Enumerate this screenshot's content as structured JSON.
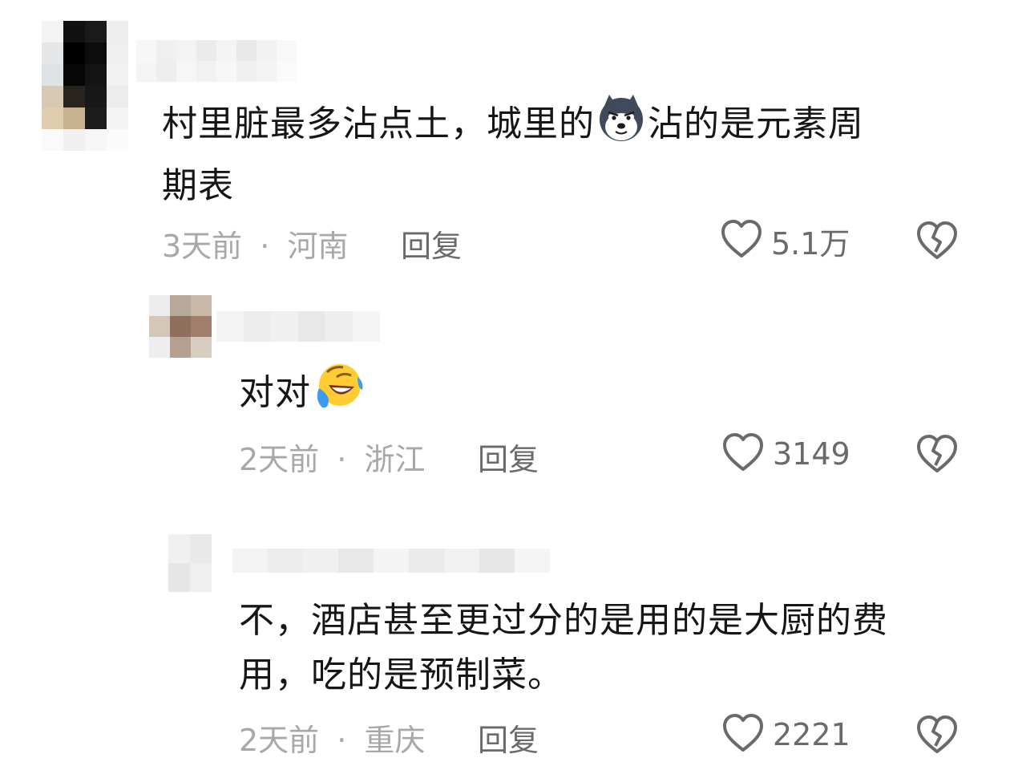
{
  "comments": [
    {
      "text_line1": "村里脏最多沾点土，城里的",
      "emoji": "husky-dog-emoji",
      "text_line1b": "沾的是元素周",
      "text_line2": "期表",
      "time": "3天前",
      "separator": "·",
      "location": "河南",
      "reply_label": "回复",
      "likes": "5.1万"
    },
    {
      "text_line1": "对对",
      "emoji": "rolling-laughing-emoji",
      "time": "2天前",
      "separator": "·",
      "location": "浙江",
      "reply_label": "回复",
      "likes": "3149"
    },
    {
      "text_line1": "不，酒店甚至更过分的是用的是大厨的费",
      "text_line2": "用，吃的是预制菜。",
      "time": "2天前",
      "separator": "·",
      "location": "重庆",
      "reply_label": "回复",
      "likes": "2221"
    }
  ],
  "icons": {
    "like": "heart-outline-icon",
    "dislike": "broken-heart-icon"
  },
  "colors": {
    "text": "#161616",
    "meta": "#a8a8a8",
    "action": "#6a6a6a"
  }
}
